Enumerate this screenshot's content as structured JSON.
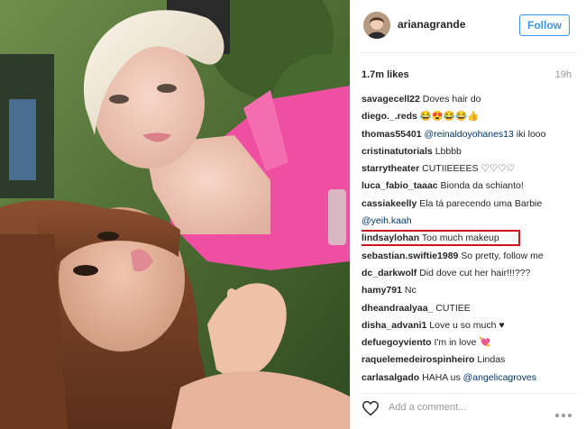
{
  "header": {
    "username": "arianagrande",
    "follow_label": "Follow"
  },
  "stats": {
    "likes": "1.7m likes",
    "time": "19h"
  },
  "comments": [
    {
      "user": "savagecell22",
      "text": " Doves hair do",
      "mention": ""
    },
    {
      "user": "diego._.reds",
      "text": " 😂😍😂😂👍",
      "mention": ""
    },
    {
      "user": "thomas55401",
      "text": "",
      "mention": " @reinaldoyohanes13",
      "after": " iki looo"
    },
    {
      "user": "cristinatutorials",
      "text": " Lbbbb",
      "mention": ""
    },
    {
      "user": "starrytheater",
      "text": " CUTIIEEEES ♡♡♡♡",
      "mention": ""
    },
    {
      "user": "luca_fabio_taaac",
      "text": " Bionda da schianto!",
      "mention": ""
    },
    {
      "user": "cassiakeelly",
      "text": " Ela tá parecendo uma Barbie",
      "mention": ""
    },
    {
      "user": "",
      "text": "",
      "mention": "@yeih.kaah"
    },
    {
      "user": "lindsaylohan",
      "text": " Too much makeup",
      "mention": "",
      "highlight": true
    },
    {
      "user": "sebastian.swiftie1989",
      "text": " So pretty, follow me",
      "mention": ""
    },
    {
      "user": "dc_darkwolf",
      "text": " Did dove cut her hair!!!???",
      "mention": ""
    },
    {
      "user": "hamy791",
      "text": " Nc",
      "mention": ""
    },
    {
      "user": "dheandraalyaa_",
      "text": " CUTIEE",
      "mention": ""
    },
    {
      "user": "disha_advani1",
      "text": " Love u so much ♥",
      "mention": ""
    },
    {
      "user": "defuegoyviento",
      "text": " I'm in love 💘",
      "mention": ""
    },
    {
      "user": "raquelemedeirospinheiro",
      "text": " Lindas",
      "mention": ""
    },
    {
      "user": "carlasalgado",
      "text": " HAHA us",
      "mention": " @angelicagroves"
    }
  ],
  "footer": {
    "add_comment_placeholder": "Add a comment...",
    "heart_icon": "heart-outline-icon",
    "more_icon": "more-options-icon"
  },
  "colors": {
    "accent": "#3897f0",
    "mention": "#003569",
    "highlight_box": "#d0161c",
    "muted": "#999999"
  }
}
